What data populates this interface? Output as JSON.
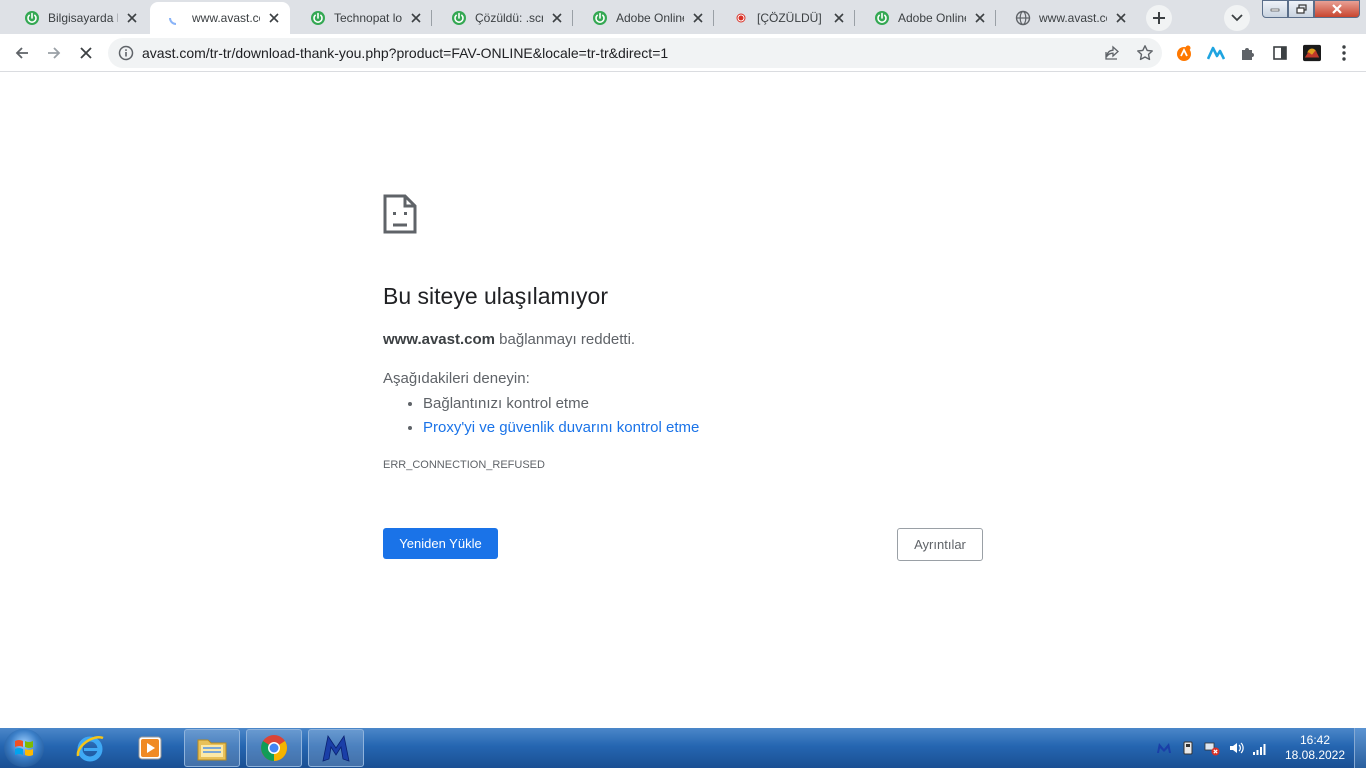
{
  "window": {
    "tabs": [
      {
        "title": "Bilgisayarda M",
        "favicon": "power-green-icon",
        "active": false
      },
      {
        "title": "www.avast.com",
        "favicon": "loading-spinner-icon",
        "active": true
      },
      {
        "title": "Technopat logi",
        "favicon": "power-green-icon",
        "active": false
      },
      {
        "title": "Çözüldü: .scr V",
        "favicon": "power-green-icon",
        "active": false
      },
      {
        "title": "Adobe Online I",
        "favicon": "power-green-icon",
        "active": false
      },
      {
        "title": "[ÇÖZÜLDÜ] .scr",
        "favicon": "red-dot-icon",
        "active": false
      },
      {
        "title": "Adobe Online I",
        "favicon": "power-green-icon",
        "active": false
      },
      {
        "title": "www.avast.com",
        "favicon": "globe-icon",
        "active": false
      }
    ]
  },
  "toolbar": {
    "url": "avast.com/tr-tr/download-thank-you.php?product=FAV-ONLINE&locale=tr-tr&direct=1"
  },
  "error_page": {
    "title": "Bu siteye ulaşılamıyor",
    "host": "www.avast.com",
    "message_suffix": " bağlanmayı reddetti.",
    "try_label": "Aşağıdakileri deneyin:",
    "suggestions": [
      {
        "text": "Bağlantınızı kontrol etme",
        "link": false
      },
      {
        "text": "Proxy'yi ve güvenlik duvarını kontrol etme",
        "link": true
      }
    ],
    "error_code": "ERR_CONNECTION_REFUSED",
    "reload_label": "Yeniden Yükle",
    "details_label": "Ayrıntılar"
  },
  "taskbar": {
    "time": "16:42",
    "date": "18.08.2022"
  },
  "colors": {
    "primary_blue": "#1a73e8",
    "tab_green": "#34a853",
    "taskbar_blue": "#2566b1"
  }
}
